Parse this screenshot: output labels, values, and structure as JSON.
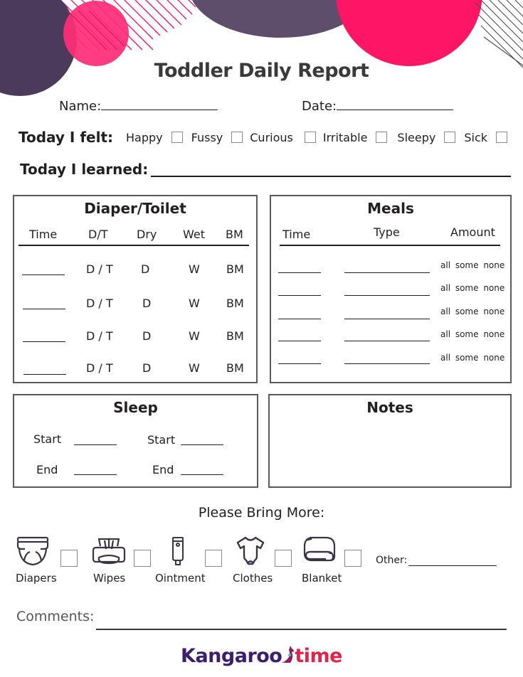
{
  "document": {
    "title": "Toddler Daily Report",
    "colors": {
      "purple": "#4b3a5c",
      "pink": "#ff1a66",
      "light_pink": "#ff3d7f",
      "text": "#231f20"
    }
  },
  "header_fields": {
    "name_label": "Name:",
    "date_label": "Date:"
  },
  "felt": {
    "label": "Today I felt:",
    "options": [
      "Happy",
      "Fussy",
      "Curious",
      "Irritable",
      "Sleepy",
      "Sick"
    ]
  },
  "learned": {
    "label": "Today I learned:"
  },
  "diaper": {
    "title": "Diaper/Toilet",
    "columns": [
      "Time",
      "D/T",
      "Dry",
      "Wet",
      "BM"
    ],
    "rows": [
      {
        "dt": "D / T",
        "dry": "D",
        "wet": "W",
        "bm": "BM"
      },
      {
        "dt": "D / T",
        "dry": "D",
        "wet": "W",
        "bm": "BM"
      },
      {
        "dt": "D / T",
        "dry": "D",
        "wet": "W",
        "bm": "BM"
      },
      {
        "dt": "D / T",
        "dry": "D",
        "wet": "W",
        "bm": "BM"
      }
    ]
  },
  "meals": {
    "title": "Meals",
    "columns": [
      "Time",
      "Type",
      "Amount"
    ],
    "rows": [
      {
        "amount": "all some none"
      },
      {
        "amount": "all some none"
      },
      {
        "amount": "all some none"
      },
      {
        "amount": "all some none"
      },
      {
        "amount": "all some none"
      }
    ]
  },
  "sleep": {
    "title": "Sleep",
    "start_label": "Start",
    "end_label": "End"
  },
  "notes": {
    "title": "Notes"
  },
  "bring_more": {
    "title": "Please Bring More:",
    "items": [
      {
        "label": "Diapers",
        "icon": "diaper-icon"
      },
      {
        "label": "Wipes",
        "icon": "wipes-icon"
      },
      {
        "label": "Ointment",
        "icon": "ointment-tube-icon"
      },
      {
        "label": "Clothes",
        "icon": "onesie-icon"
      },
      {
        "label": "Blanket",
        "icon": "folded-blanket-icon"
      }
    ],
    "other_label": "Other:"
  },
  "comments": {
    "label": "Comments:"
  },
  "brand": {
    "part1": "Kangaroo",
    "part2": "time"
  }
}
